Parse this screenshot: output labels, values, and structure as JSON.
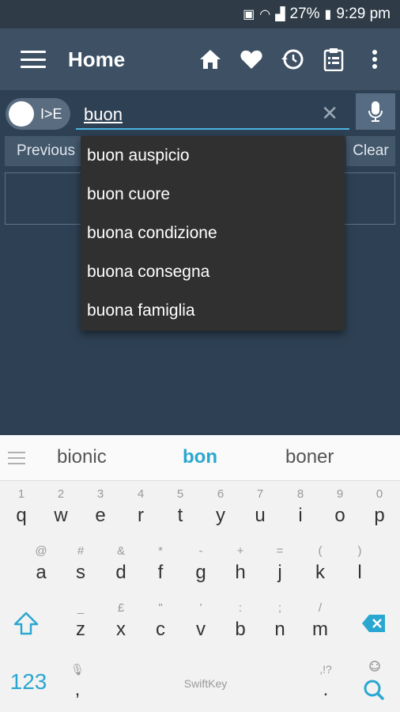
{
  "status_bar": {
    "battery": "27%",
    "time": "9:29 pm"
  },
  "app_bar": {
    "title": "Home",
    "icons": [
      "menu-icon",
      "home-icon",
      "heart-icon",
      "history-icon",
      "clipboard-icon",
      "more-vert-icon"
    ]
  },
  "search": {
    "toggle_label": "I>E",
    "query": "buon",
    "previous_label": "Previous",
    "clear_label": "Clear"
  },
  "suggestions_dropdown": [
    "buon auspicio",
    "buon cuore",
    "buona condizione",
    "buona consegna",
    "buona famiglia"
  ],
  "keyboard": {
    "predictions": [
      "bionic",
      "bon",
      "boner"
    ],
    "row1": [
      {
        "alt": "1",
        "main": "q"
      },
      {
        "alt": "2",
        "main": "w"
      },
      {
        "alt": "3",
        "main": "e"
      },
      {
        "alt": "4",
        "main": "r"
      },
      {
        "alt": "5",
        "main": "t"
      },
      {
        "alt": "6",
        "main": "y"
      },
      {
        "alt": "7",
        "main": "u"
      },
      {
        "alt": "8",
        "main": "i"
      },
      {
        "alt": "9",
        "main": "o"
      },
      {
        "alt": "0",
        "main": "p"
      }
    ],
    "row2": [
      {
        "alt": "@",
        "main": "a"
      },
      {
        "alt": "#",
        "main": "s"
      },
      {
        "alt": "&",
        "main": "d"
      },
      {
        "alt": "*",
        "main": "f"
      },
      {
        "alt": "-",
        "main": "g"
      },
      {
        "alt": "+",
        "main": "h"
      },
      {
        "alt": "=",
        "main": "j"
      },
      {
        "alt": "(",
        "main": "k"
      },
      {
        "alt": ")",
        "main": "l"
      }
    ],
    "row3": [
      {
        "alt": "_",
        "main": "z"
      },
      {
        "alt": "£",
        "main": "x"
      },
      {
        "alt": "\"",
        "main": "c"
      },
      {
        "alt": "'",
        "main": "v"
      },
      {
        "alt": ":",
        "main": "b"
      },
      {
        "alt": ";",
        "main": "n"
      },
      {
        "alt": "/",
        "main": "m"
      }
    ],
    "numbers_label": "123",
    "comma": ",",
    "space_brand": "SwiftKey",
    "period_alt": ",!?",
    "period": "."
  },
  "colors": {
    "accent": "#2aa7d1",
    "appbar": "#3e5164",
    "content": "#2e4154"
  }
}
